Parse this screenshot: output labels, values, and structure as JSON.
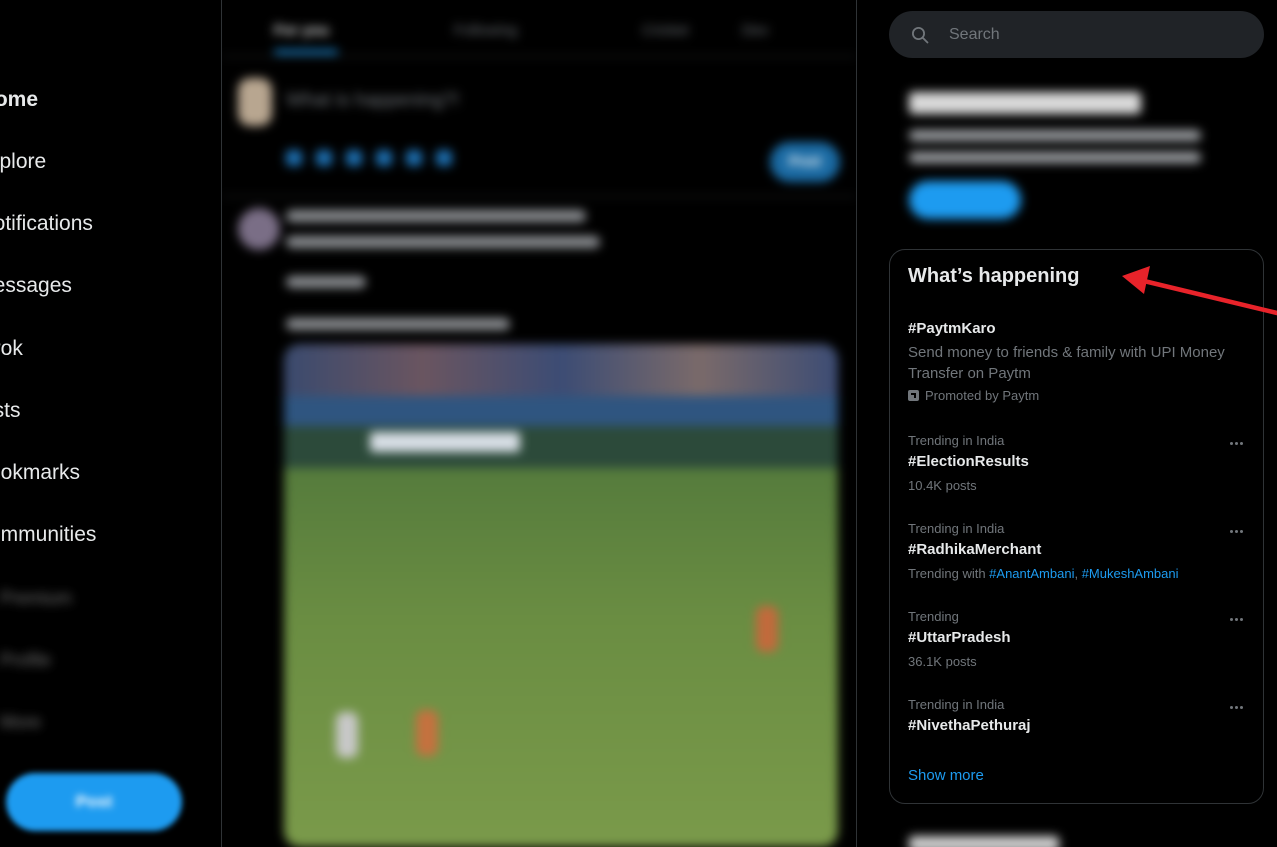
{
  "nav": {
    "items": [
      {
        "label": "Home",
        "display": "lome"
      },
      {
        "label": "Explore",
        "display": "xplore"
      },
      {
        "label": "Notifications",
        "display": "lotifications"
      },
      {
        "label": "Messages",
        "display": "lessages"
      },
      {
        "label": "Grok",
        "display": "irok"
      },
      {
        "label": "Lists",
        "display": "ists"
      },
      {
        "label": "Bookmarks",
        "display": "ookmarks"
      },
      {
        "label": "Communities",
        "display": "ommunities"
      },
      {
        "label": "Premium"
      },
      {
        "label": "Profile"
      },
      {
        "label": "More"
      }
    ],
    "post_label": "Post"
  },
  "center": {
    "tabs": [
      "For you",
      "Following",
      "Cricket",
      "Dev"
    ],
    "composer_placeholder": "What is happening?!",
    "composer_button": "Post"
  },
  "search": {
    "placeholder": "Search"
  },
  "premium": {
    "title": "Subscribe to Premium",
    "body": "Subscribe to unlock new features and if eligible, receive a share of ads revenue.",
    "button": "Subscribe"
  },
  "trends": {
    "title": "What’s happening",
    "promoted": {
      "name": "#PaytmKaro",
      "description": "Send money to friends & family with UPI Money Transfer on Paytm",
      "promoted_by": "Promoted by Paytm"
    },
    "items": [
      {
        "context": "Trending in India",
        "name": "#ElectionResults",
        "posts": "10.4K posts"
      },
      {
        "context": "Trending in India",
        "name": "#RadhikaMerchant",
        "trending_with_prefix": "Trending with ",
        "trending_with": [
          "#AnantAmbani",
          "#MukeshAmbani"
        ]
      },
      {
        "context": "Trending",
        "name": "#UttarPradesh",
        "posts": "36.1K posts"
      },
      {
        "context": "Trending in India",
        "name": "#NivethaPethuraj"
      }
    ],
    "show_more": "Show more"
  },
  "who_to_follow": {
    "title": "Who to follow"
  },
  "colors": {
    "background": "#000000",
    "accent": "#1d9bf0",
    "text_primary": "#e7e9ea",
    "text_secondary": "#71767b",
    "annotation_arrow": "#e8232a"
  }
}
